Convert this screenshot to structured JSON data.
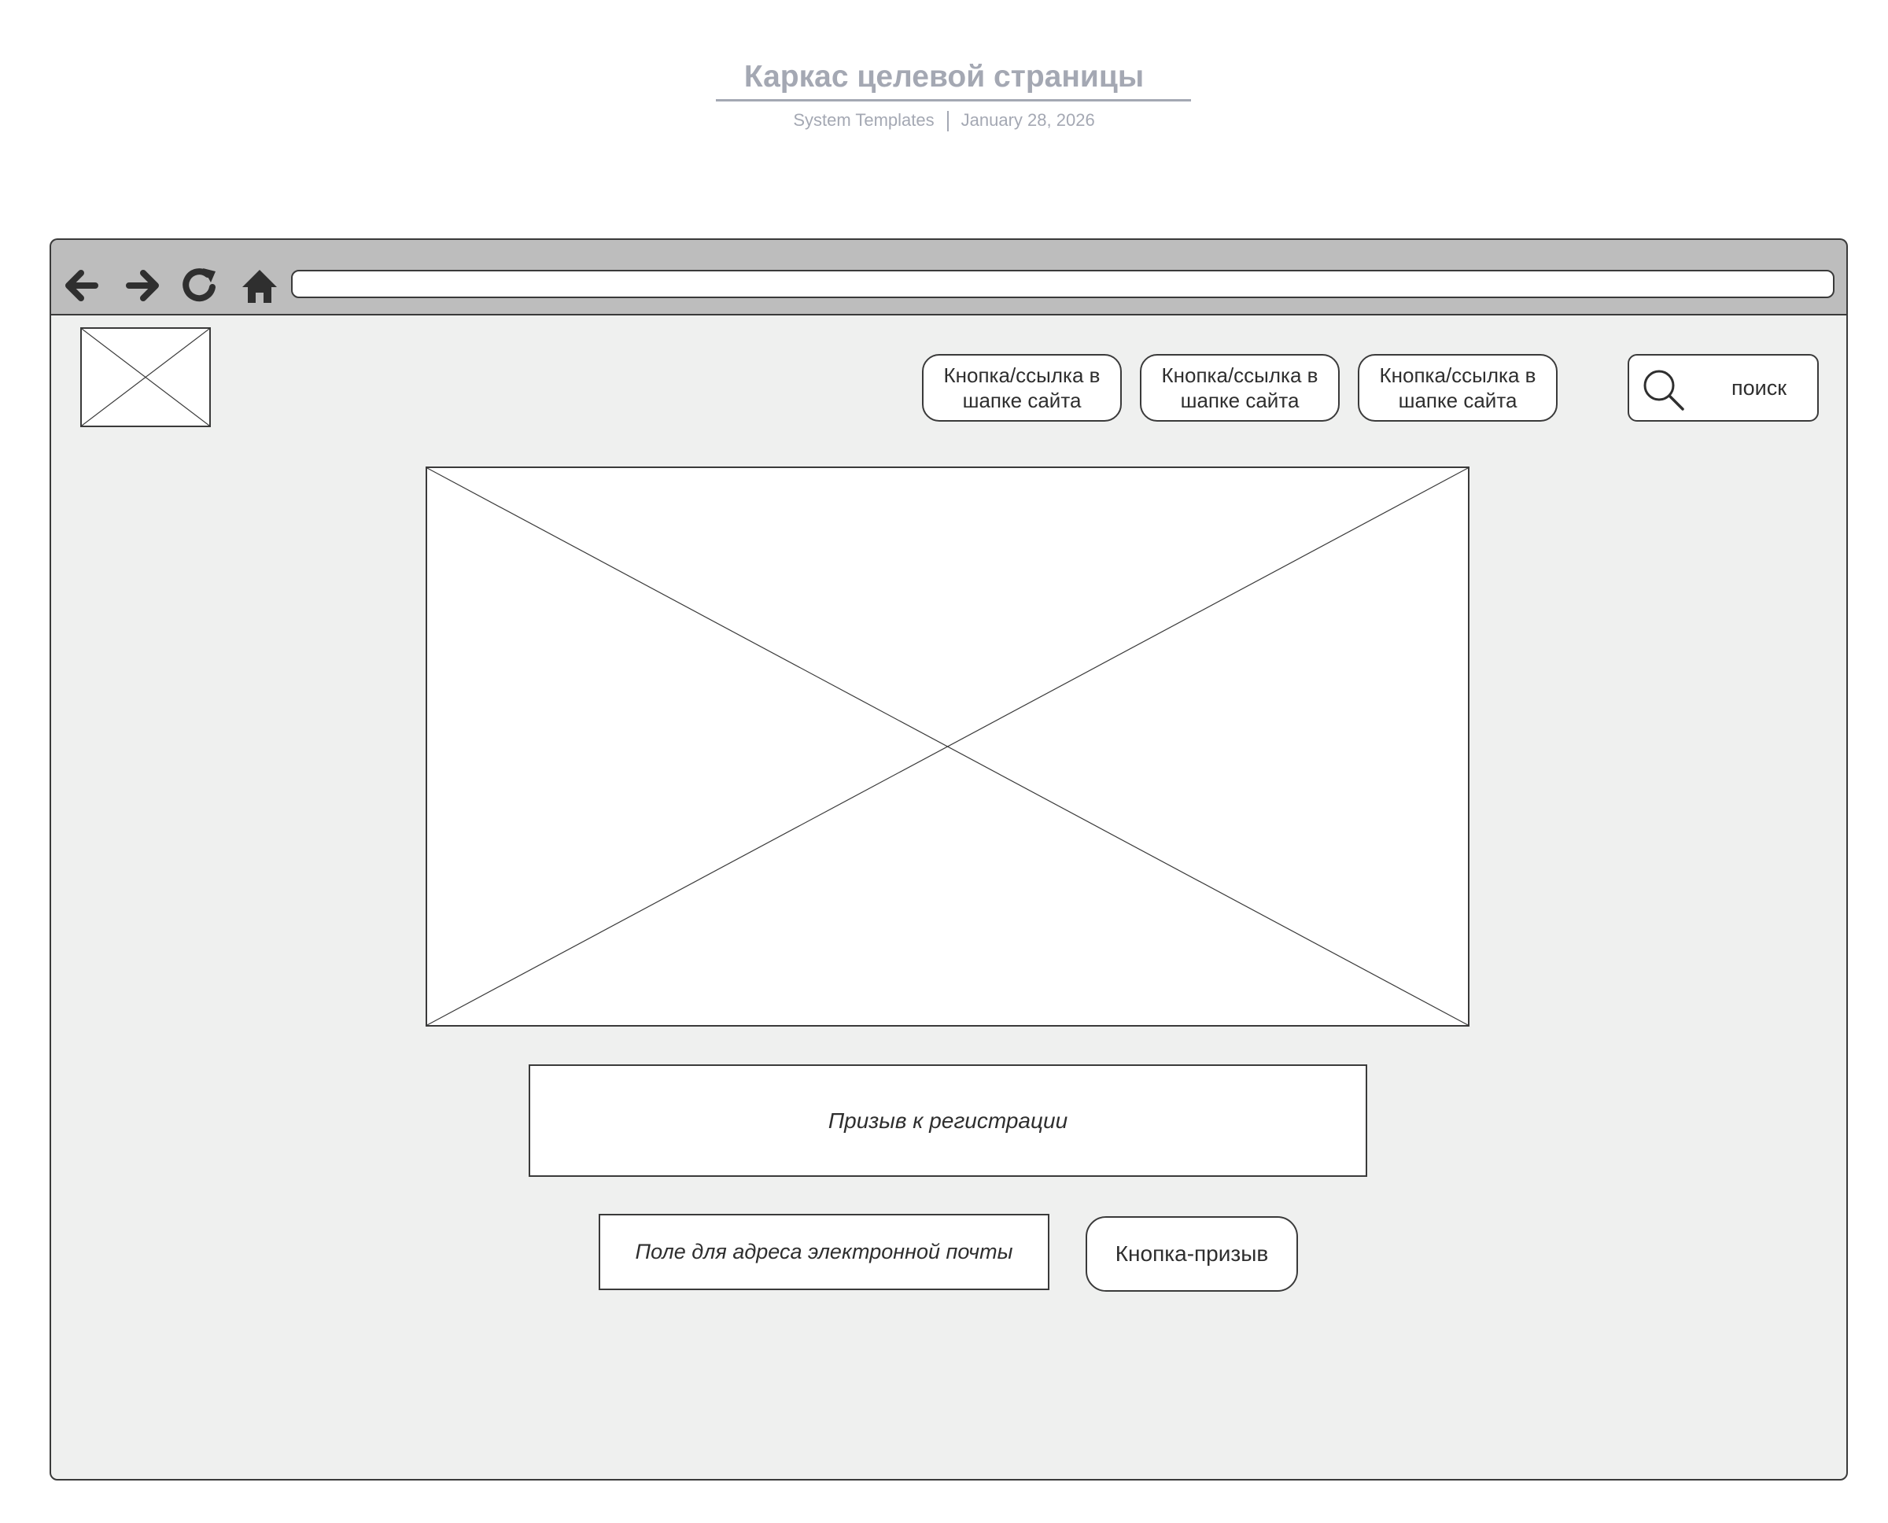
{
  "document": {
    "title": "Каркас целевой страницы",
    "source": "System Templates",
    "date": "January 28, 2026"
  },
  "browser": {
    "nav_icons": [
      "back-arrow-icon",
      "forward-arrow-icon",
      "reload-icon",
      "home-icon"
    ],
    "address": ""
  },
  "header": {
    "logo": "image-placeholder-icon",
    "links": [
      {
        "label": "Кнопка/ссылка в шапке сайта"
      },
      {
        "label": "Кнопка/ссылка в шапке сайта"
      },
      {
        "label": "Кнопка/ссылка в шапке сайта"
      }
    ],
    "search": {
      "label": "поиск",
      "icon": "search-icon"
    }
  },
  "main": {
    "hero_image": "image-placeholder-icon",
    "cta_banner": "Призыв к регистрации",
    "email_field": "Поле для адреса электронной почты",
    "cta_button": "Кнопка-призыв"
  },
  "colors": {
    "title": "#a4a8b3",
    "toolbar": "#bdbdbd",
    "viewport": "#eff0ef",
    "stroke": "#3a3a3a"
  }
}
